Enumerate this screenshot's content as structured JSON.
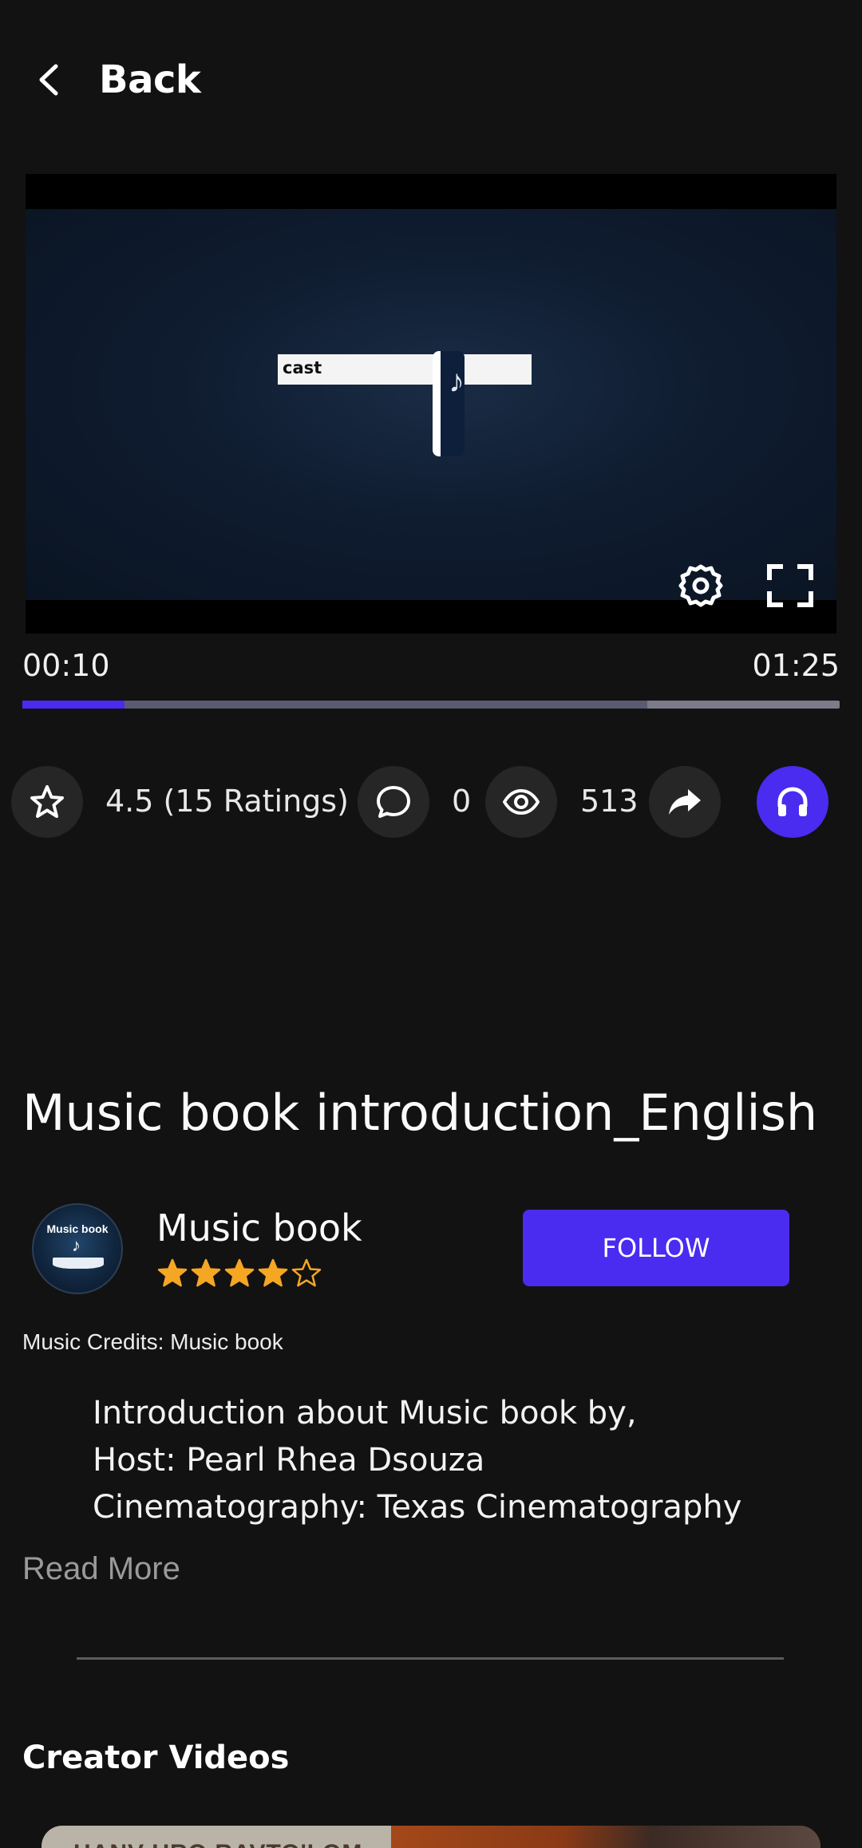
{
  "header": {
    "back_label": "Back"
  },
  "player": {
    "overlay_text": "cast",
    "current_time": "00:10",
    "total_time": "01:25",
    "progress_fraction": 0.125,
    "buffered_fraction": 0.765
  },
  "stats": {
    "rating": "4.5 (15 Ratings)",
    "comments": "0",
    "views": "513"
  },
  "video": {
    "title": "Music book introduction_English"
  },
  "creator": {
    "name": "Music book",
    "avatar_text": "Music book",
    "rating_stars": 4,
    "max_stars": 5,
    "follow_label": "FOLLOW"
  },
  "credits": "Music Credits: Music book",
  "description": {
    "line1": "Introduction about Music book by,",
    "line2": "Host: Pearl Rhea Dsouza",
    "line3": "Cinematography: Texas Cinematography"
  },
  "read_more_label": "Read More",
  "creator_videos": {
    "section_title": "Creator Videos",
    "first_thumb_text": "HANV URO RAVTO'LOM"
  },
  "colors": {
    "accent": "#4a2bf0",
    "star": "#f5a623",
    "background": "#121212"
  }
}
